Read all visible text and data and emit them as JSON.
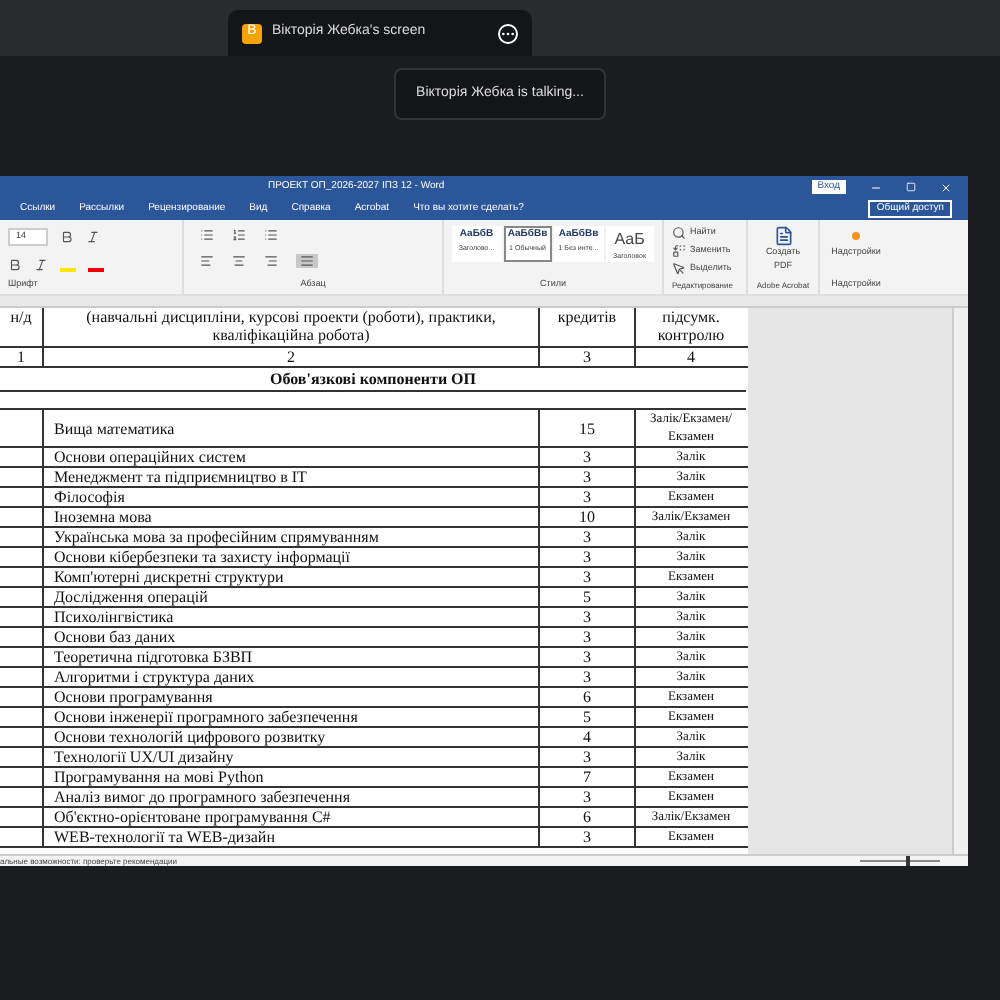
{
  "call": {
    "screen_tab": {
      "badge": "В",
      "title": "Вікторія Жебка's screen"
    },
    "toast": "Вікторія Жебка is talking..."
  },
  "word": {
    "title": "ПРОЕКТ ОП_2026-2027 ІПЗ 12 - Word",
    "signin": "Вход",
    "share": "Общий доступ",
    "tabs": [
      {
        "label": "Ссылки",
        "selected": false
      },
      {
        "label": "Рассылки",
        "selected": false
      },
      {
        "label": "Рецензирование",
        "selected": false
      },
      {
        "label": "Вид",
        "selected": false
      },
      {
        "label": "Справка",
        "selected": false
      },
      {
        "label": "Acrobat",
        "selected": false
      }
    ],
    "tell_me": "Что вы хотите сделать?",
    "font_size": "14",
    "groups": [
      "Шрифт",
      "Абзац",
      "Стили",
      "Редактирование",
      "Adobe Acrobat",
      "Надстройки"
    ],
    "styles": [
      {
        "sample": "АаБбВ",
        "name": "Заголово...",
        "selected": false
      },
      {
        "sample": "АаБбВв",
        "name": "1 Обычный",
        "selected": true
      },
      {
        "sample": "АаБбВв",
        "name": "1 Без инте...",
        "selected": false
      },
      {
        "sample": "АаБ",
        "name": "Заголовок",
        "selected": false
      }
    ],
    "editing": [
      "Найти",
      "Заменить",
      "Выделить"
    ],
    "create_pdf": "Создать PDF",
    "addins": "Надстройки",
    "table": {
      "header": [
        "н/д",
        "(навчальні дисципліни, курсові проекти (роботи), практики, кваліфікаційна робота)",
        "кредитів",
        "підсумк. контролю"
      ],
      "numbers": [
        "1",
        "2",
        "3",
        "4"
      ],
      "section": "Обов'язкові компоненти ОП",
      "rows": [
        [
          "Вища математика",
          "15",
          "Залік/Екзамен/ Екзамен"
        ],
        [
          "Основи операційних систем",
          "3",
          "Залік"
        ],
        [
          "Менеджмент та підприємництво в ІТ",
          "3",
          "Залік"
        ],
        [
          "Філософія",
          "3",
          "Екзамен"
        ],
        [
          "Іноземна мова",
          "10",
          "Залік/Екзамен"
        ],
        [
          "Українська мова за професійним спрямуванням",
          "3",
          "Залік"
        ],
        [
          "Основи кібербезпеки та захисту інформації",
          "3",
          "Залік"
        ],
        [
          "Комп'ютерні дискретні структури",
          "3",
          "Екзамен"
        ],
        [
          "Дослідження операцій",
          "5",
          "Залік"
        ],
        [
          "Психолінгвістика",
          "3",
          "Залік"
        ],
        [
          "Основи баз даних",
          "3",
          "Залік"
        ],
        [
          "Теоретична підготовка БЗВП",
          "3",
          "Залік"
        ],
        [
          "Алгоритми і структура даних",
          "3",
          "Залік"
        ],
        [
          "Основи програмування",
          "6",
          "Екзамен"
        ],
        [
          "Основи інженерії програмного забезпечення",
          "5",
          "Екзамен"
        ],
        [
          "Основи технологій цифрового розвитку",
          "4",
          "Залік"
        ],
        [
          "Технології UX/UI дизайну",
          "3",
          "Залік"
        ],
        [
          "Програмування на мові Python",
          "7",
          "Екзамен"
        ],
        [
          "Аналіз вимог до програмного забезпечення",
          "3",
          "Екзамен"
        ],
        [
          "Об'єктно-орієнтоване програмування C#",
          "6",
          "Залік/Екзамен"
        ],
        [
          "WEB-технології та WEB-дизайн",
          "3",
          "Екзамен"
        ]
      ]
    },
    "status": "альные возможности: проверьте рекомендации",
    "zoom": {
      "level": 0.6
    }
  }
}
